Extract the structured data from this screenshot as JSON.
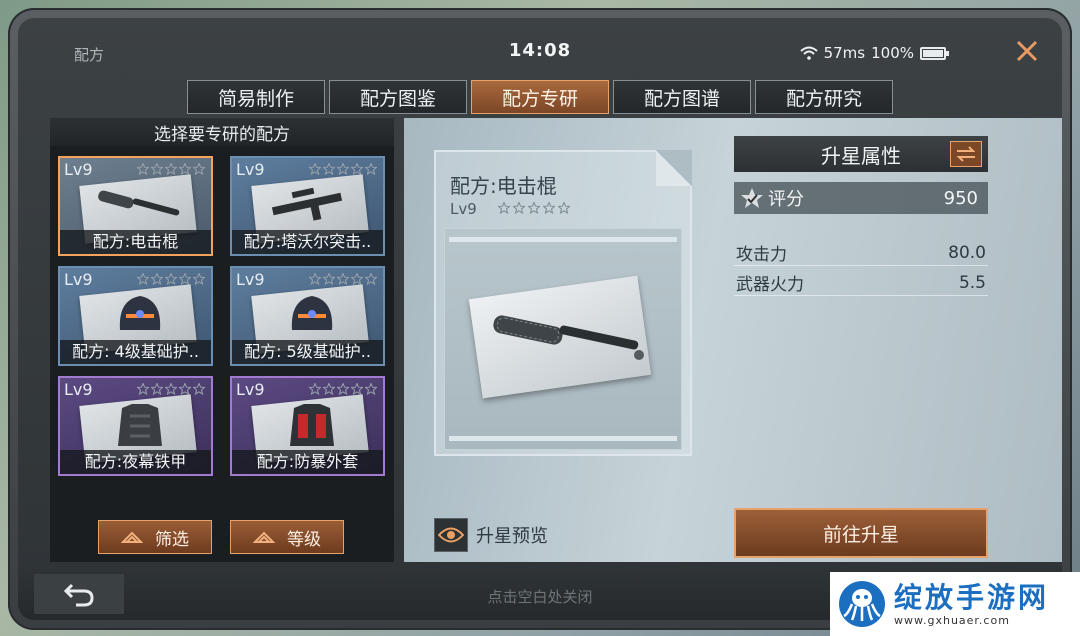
{
  "status": {
    "title": "配方",
    "time": "14:08",
    "ping": "57ms",
    "battery": "100%",
    "battery_level": 1.0
  },
  "tabs": [
    {
      "label": "简易制作",
      "active": false
    },
    {
      "label": "配方图鉴",
      "active": false
    },
    {
      "label": "配方专研",
      "active": true
    },
    {
      "label": "配方图谱",
      "active": false
    },
    {
      "label": "配方研究",
      "active": false
    }
  ],
  "left_panel": {
    "header": "选择要专研的配方",
    "cards": [
      {
        "level": "Lv9",
        "label": "配方:电击棍",
        "stars": 5,
        "item": "baton"
      },
      {
        "level": "Lv9",
        "label": "配方:塔沃尔突击..",
        "stars": 5,
        "item": "rifle"
      },
      {
        "level": "Lv9",
        "label": "配方: 4级基础护..",
        "stars": 5,
        "item": "helmet"
      },
      {
        "level": "Lv9",
        "label": "配方: 5级基础护..",
        "stars": 5,
        "item": "helmet"
      },
      {
        "level": "Lv9",
        "label": "配方:夜幕铁甲",
        "stars": 4,
        "item": "armor"
      },
      {
        "level": "Lv9",
        "label": "配方:防暴外套",
        "stars": 4,
        "item": "jacket"
      }
    ],
    "filter_label": "筛选",
    "level_label": "等级"
  },
  "detail": {
    "title": "配方:电击棍",
    "level": "Lv9",
    "stars": 5,
    "preview_label": "升星预览"
  },
  "attributes": {
    "header": "升星属性",
    "score_label": "评分",
    "score_value": "950",
    "rows": [
      {
        "label": "攻击力",
        "value": "80.0"
      },
      {
        "label": "武器火力",
        "value": "5.5"
      }
    ],
    "upgrade_label": "前往升星"
  },
  "bottom": {
    "close_hint": "点击空白处关闭"
  },
  "watermark": {
    "name": "绽放手游网",
    "url": "www.gxhuaer.com"
  },
  "colors": {
    "accent": "#e7a16b",
    "accent_bg": "#7c4626",
    "card_blue": "#6a8fb2",
    "card_purple": "#a27bd1",
    "watermark_blue": "#1c6fc0"
  }
}
